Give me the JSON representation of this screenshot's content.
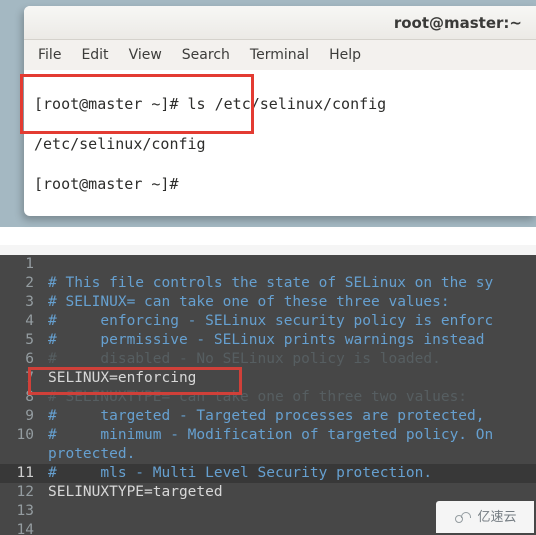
{
  "window": {
    "title": "root@master:~",
    "menu": [
      "File",
      "Edit",
      "View",
      "Search",
      "Terminal",
      "Help"
    ]
  },
  "terminal": {
    "lines": [
      "[root@master ~]# ls /etc/selinux/config",
      "/etc/selinux/config",
      "[root@master ~]# "
    ]
  },
  "editor": {
    "lines": [
      {
        "n": 1,
        "cls": "row",
        "text": ""
      },
      {
        "n": 2,
        "cls": "row comment",
        "text": "# This file controls the state of SELinux on the sy"
      },
      {
        "n": 3,
        "cls": "row comment",
        "text": "# SELINUX= can take one of these three values:"
      },
      {
        "n": 4,
        "cls": "row comment",
        "text": "#     enforcing - SELinux security policy is enforc"
      },
      {
        "n": 5,
        "cls": "row comment",
        "text": "#     permissive - SELinux prints warnings instead "
      },
      {
        "n": 6,
        "cls": "row dim",
        "text": "#     disabled - No SELinux policy is loaded."
      },
      {
        "n": 7,
        "cls": "row setting",
        "text": "SELINUX=enforcing"
      },
      {
        "n": 8,
        "cls": "row dim",
        "text": "# SELINUXTYPE= can take one of three two values:"
      },
      {
        "n": 9,
        "cls": "row comment",
        "text": "#     targeted - Targeted processes are protected,"
      },
      {
        "n": 10,
        "cls": "row comment",
        "text": "#     minimum - Modification of targeted policy. On"
      },
      {
        "n": "",
        "cls": "row comment",
        "text": "protected."
      },
      {
        "n": 11,
        "cls": "row current-row comment",
        "text": "#     mls - Multi Level Security protection."
      },
      {
        "n": 12,
        "cls": "row setting",
        "text": "SELINUXTYPE=targeted"
      },
      {
        "n": 13,
        "cls": "row",
        "text": ""
      },
      {
        "n": 14,
        "cls": "row",
        "text": ""
      }
    ],
    "current_line": 11
  },
  "watermark": {
    "text": "亿速云"
  }
}
